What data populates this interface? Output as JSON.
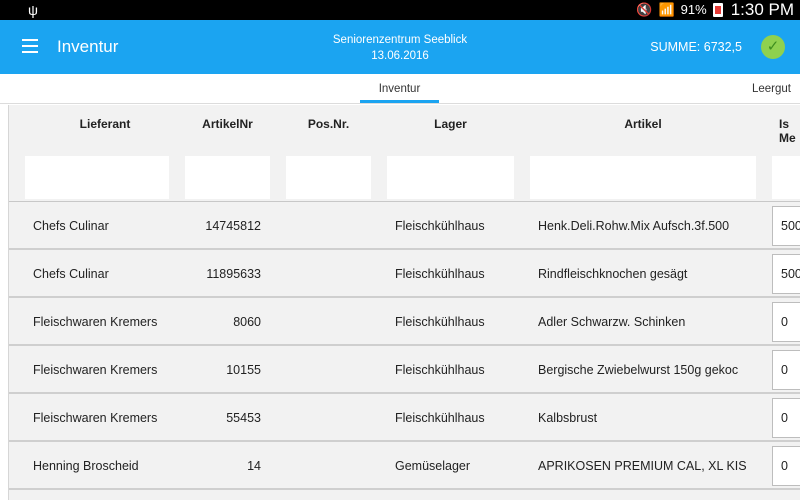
{
  "statusbar": {
    "usb_icon": "usb-icon",
    "mute_icon": "mute-icon",
    "wifi_icon": "wifi-icon",
    "battery_percent": "91%",
    "time": "1:30 PM"
  },
  "appbar": {
    "title": "Inventur",
    "facility": "Seniorenzentrum Seeblick",
    "date": "13.06.2016",
    "summe": "SUMME: 6732,5",
    "accent": "#1ba4f1",
    "check_color": "#8fd14f"
  },
  "tabs": [
    {
      "label": "Inventur",
      "active": true
    },
    {
      "label": "Leergut",
      "active": false
    }
  ],
  "table": {
    "headers": {
      "lieferant": "Lieferant",
      "artikelnr": "ArtikelNr",
      "posnr": "Pos.Nr.",
      "lager": "Lager",
      "artikel": "Artikel",
      "menge_line1": "Is",
      "menge_line2": "Me"
    },
    "rows": [
      {
        "lieferant": "Chefs Culinar",
        "artikelnr": "14745812",
        "posnr": "",
        "lager": "Fleischkühlhaus",
        "artikel": "Henk.Deli.Rohw.Mix  Aufsch.3f.500",
        "menge": "500"
      },
      {
        "lieferant": "Chefs Culinar",
        "artikelnr": "11895633",
        "posnr": "",
        "lager": "Fleischkühlhaus",
        "artikel": "Rindfleischknochen gesägt",
        "menge": "500"
      },
      {
        "lieferant": "Fleischwaren Kremers",
        "artikelnr": "8060",
        "posnr": "",
        "lager": "Fleischkühlhaus",
        "artikel": "Adler Schwarzw. Schinken",
        "menge": "0"
      },
      {
        "lieferant": "Fleischwaren Kremers",
        "artikelnr": "10155",
        "posnr": "",
        "lager": "Fleischkühlhaus",
        "artikel": "Bergische Zwiebelwurst 150g gekoc",
        "menge": "0"
      },
      {
        "lieferant": "Fleischwaren Kremers",
        "artikelnr": "55453",
        "posnr": "",
        "lager": "Fleischkühlhaus",
        "artikel": "Kalbsbrust",
        "menge": "0"
      },
      {
        "lieferant": "Henning Broscheid",
        "artikelnr": "14",
        "posnr": "",
        "lager": "Gemüselager",
        "artikel": "APRIKOSEN PREMIUM CAL, XL  KIS",
        "menge": "0"
      }
    ]
  }
}
